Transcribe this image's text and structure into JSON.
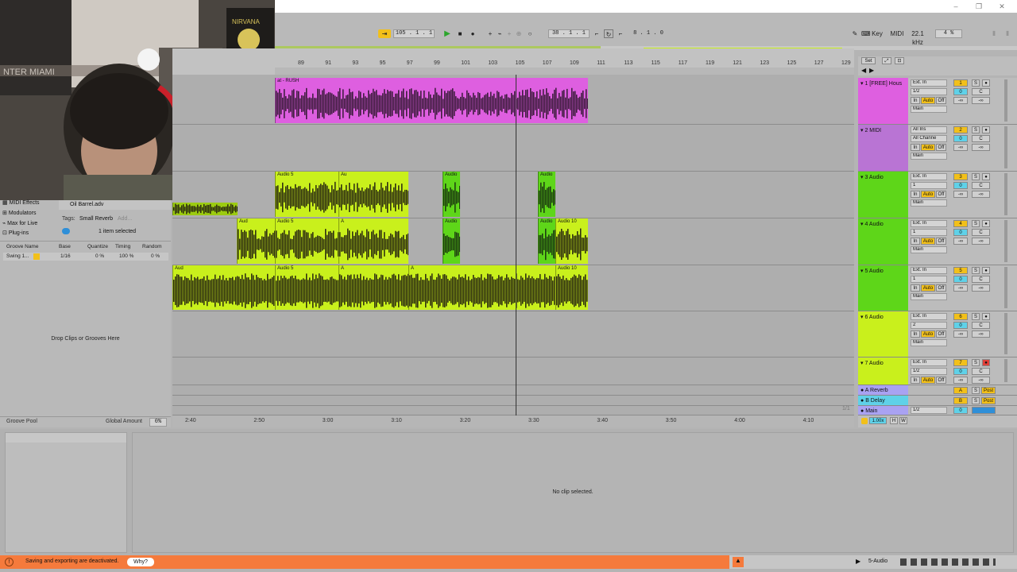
{
  "colors": {
    "pink": "#de5fe0",
    "purple": "#b974d4",
    "green": "#5ed619",
    "lime": "#c9f01c",
    "orange": "#f57a3c",
    "yellow": "#f2c01a",
    "cyan": "#5fd1e8",
    "lavender": "#a9a2f2"
  },
  "transport": {
    "tempo": "105 .  1 .  1",
    "position": "38 .  1 .  1",
    "loop_length": "8 .  1 .  0",
    "key_label": "Key",
    "midi_label": "MIDI",
    "sample_rate": "22.1 kHz",
    "cpu": "4 %"
  },
  "ruler": {
    "bars": [
      "89",
      "91",
      "93",
      "95",
      "97",
      "99",
      "101",
      "103",
      "105",
      "107",
      "109",
      "111",
      "113",
      "115",
      "117",
      "119",
      "121",
      "123",
      "125",
      "127",
      "129"
    ],
    "set_label": "Set"
  },
  "time_ruler": [
    "2:40",
    "2:50",
    "3:00",
    "3:10",
    "3:20",
    "3:30",
    "3:40",
    "3:50",
    "4:00",
    "4:10"
  ],
  "browser": {
    "items": [
      "MIDI Effects",
      "Modulators",
      "Max for Live",
      "Plug-ins"
    ],
    "file": "Oil Barrel.adv",
    "tags_label": "Tags:",
    "tag": "Small Reverb",
    "tag_add": "Add...",
    "selection": "1 item selected",
    "groove_headers": [
      "Groove Name",
      "Base",
      "Quantize",
      "Timing",
      "Random"
    ],
    "groove_row": {
      "name": "Swing 1...",
      "base": "1/16",
      "quantize": "0 %",
      "timing": "100 %",
      "random": "0 %"
    },
    "drop_hint": "Drop Clips or Grooves Here",
    "groove_pool": "Groove Pool",
    "global_amount": "Global Amount",
    "global_value": "0%"
  },
  "clips": {
    "track1": "at - RUSH",
    "audio5": "Audio 5",
    "audio": "Audio",
    "aud": "Aud",
    "audio10": "Audio 10",
    "a": "A",
    "au": "Au"
  },
  "tracks": [
    {
      "name": "1 [FREE] Hous",
      "num": "1",
      "input": "Ext. In",
      "channel": "1/2"
    },
    {
      "name": "2 MIDI",
      "num": "2",
      "input": "All Ins",
      "channel": "All Channe"
    },
    {
      "name": "3 Audio",
      "num": "3",
      "input": "Ext. In",
      "channel": "1"
    },
    {
      "name": "4 Audio",
      "num": "4",
      "input": "Ext. In",
      "channel": "1"
    },
    {
      "name": "5 Audio",
      "num": "5",
      "input": "Ext. In",
      "channel": "1"
    },
    {
      "name": "6 Audio",
      "num": "6",
      "input": "Ext. In",
      "channel": "2"
    },
    {
      "name": "7 Audio",
      "num": "7",
      "input": "Ext. In",
      "channel": "1/2"
    }
  ],
  "mixer_labels": {
    "in": "In",
    "auto": "Auto",
    "off": "Off",
    "main": "Main",
    "s": "S",
    "c": "C",
    "zero": "0",
    "neg_inf": "-∞"
  },
  "returns": [
    {
      "name": "A Reverb",
      "letter": "A",
      "post": "Post"
    },
    {
      "name": "B Delay",
      "letter": "B",
      "post": "Post"
    }
  ],
  "main_track": {
    "name": "Main",
    "ratio": "1/2",
    "zero": "0",
    "page": "1/1"
  },
  "zoom_label": "1.00x",
  "h_label": "H",
  "w_label": "W",
  "detail": {
    "no_clip": "No clip selected."
  },
  "status": {
    "message": "Saving and exporting are deactivated.",
    "why": "Why?",
    "track": "5-Audio"
  }
}
